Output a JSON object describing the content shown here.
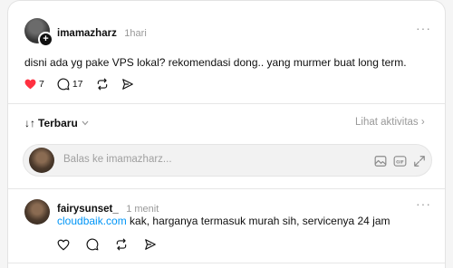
{
  "post": {
    "username": "imamazharz",
    "time": "1hari",
    "text": "disni ada yg pake VPS lokal? rekomendasi dong.. yang murmer buat long term.",
    "likes": "7",
    "comments": "17",
    "more": "···",
    "avatar_badge": "+"
  },
  "sort": {
    "label": "Terbaru",
    "icon": "↓↑",
    "activity_link": "Lihat aktivitas ›"
  },
  "reply_box": {
    "placeholder": "Balas ke imamazharz..."
  },
  "reply": {
    "username": "fairysunset_",
    "time": "1 menit",
    "link_text": "cloudbaik.com",
    "text": " kak, harganya termasuk murah sih, servicenya 24 jam",
    "more": "···"
  },
  "colors": {
    "like_red": "#ff3040",
    "link_blue": "#0095f6"
  }
}
